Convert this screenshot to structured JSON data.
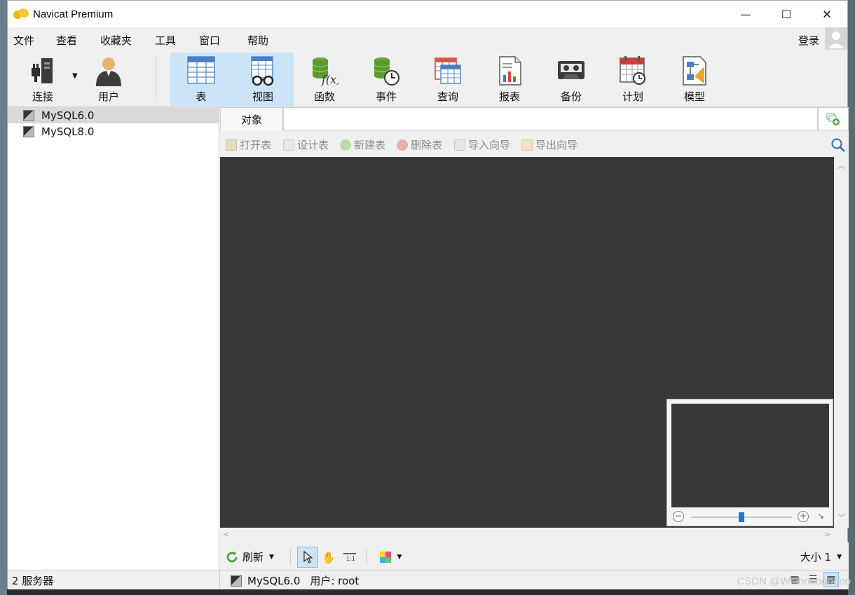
{
  "window": {
    "title": "Navicat Premium"
  },
  "win_controls": {
    "minimize": "—",
    "maximize": "☐",
    "close": "✕"
  },
  "menu": {
    "items": [
      "文件",
      "查看",
      "收藏夹",
      "工具",
      "窗口",
      "帮助"
    ],
    "login": "登录"
  },
  "toolbar": {
    "items": [
      {
        "label": "连接",
        "icon": "plug-icon"
      },
      {
        "label": "用户",
        "icon": "user-icon"
      },
      {
        "label": "表",
        "icon": "table-icon",
        "active": true
      },
      {
        "label": "视图",
        "icon": "view-icon"
      },
      {
        "label": "函数",
        "icon": "function-icon"
      },
      {
        "label": "事件",
        "icon": "event-icon"
      },
      {
        "label": "查询",
        "icon": "query-icon"
      },
      {
        "label": "报表",
        "icon": "report-icon"
      },
      {
        "label": "备份",
        "icon": "backup-icon"
      },
      {
        "label": "计划",
        "icon": "schedule-icon"
      },
      {
        "label": "模型",
        "icon": "model-icon"
      }
    ]
  },
  "sidebar": {
    "connections": [
      {
        "label": "MySQL6.0",
        "selected": true
      },
      {
        "label": "MySQL8.0",
        "selected": false
      }
    ]
  },
  "tabs": {
    "object": "对象"
  },
  "object_toolbar": {
    "open": "打开表",
    "design": "设计表",
    "new": "新建表",
    "delete": "删除表",
    "import": "导入向导",
    "export": "导出向导"
  },
  "minimap": {
    "zoom_level": 0.5
  },
  "bottombar": {
    "refresh": "刷新",
    "size_label": "大小 1"
  },
  "status": {
    "servers": "2 服务器",
    "connection": "MySQL6.0",
    "user": "用户: root"
  },
  "watermark": "CSDN @Weihoooooooo",
  "colors": {
    "accent": "#cce4f7",
    "canvas": "#383838",
    "selected_row": "#d9d9d9"
  }
}
